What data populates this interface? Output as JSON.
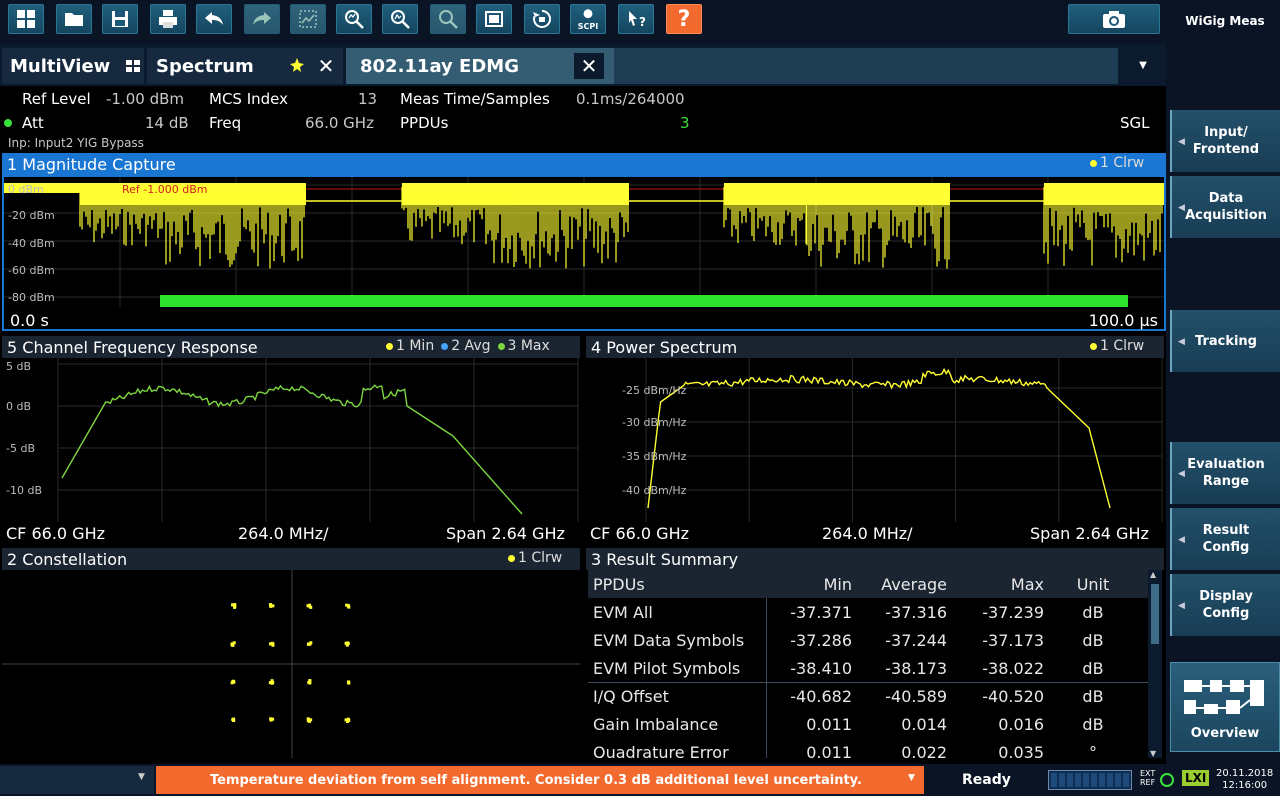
{
  "toolbar": {
    "icons": [
      "windows-icon",
      "open-folder-icon",
      "save-icon",
      "print-icon",
      "undo-icon",
      "redo-icon",
      "zoom-area-icon",
      "zoom-multi-icon",
      "zoom-result-icon",
      "zoom-off-icon",
      "fullscreen-icon",
      "sequence-icon",
      "sopi-icon",
      "help-pointer-icon",
      "help-icon"
    ],
    "sopi_label": "SCPI",
    "help_label": "?",
    "app_name": "WiGig Meas"
  },
  "tabs": [
    {
      "label": "MultiView"
    },
    {
      "label": "Spectrum"
    },
    {
      "label": "802.11ay EDMG"
    }
  ],
  "info": {
    "ref_level_label": "Ref Level",
    "ref_level_value": "-1.00 dBm",
    "att_label": "Att",
    "att_value": "14 dB",
    "mcs_label": "MCS Index",
    "mcs_value": "13",
    "freq_label": "Freq",
    "freq_value": "66.0 GHz",
    "meas_label": "Meas Time/Samples",
    "meas_value": "0.1ms/264000",
    "ppdus_label": "PPDUs",
    "ppdus_value": "3",
    "sgl": "SGL",
    "input": "Inp: Input2 YIG Bypass"
  },
  "win1": {
    "title": "1 Magnitude Capture",
    "legend": "1 Clrw",
    "ref_label": "Ref -1.000 dBm",
    "y_ticks": [
      "0 dBm",
      "-20 dBm",
      "-40 dBm",
      "-60 dBm",
      "-80 dBm"
    ],
    "x_start": "0.0 s",
    "x_end": "100.0 µs"
  },
  "win5": {
    "title": "5 Channel Frequency Response",
    "legend": [
      "1 Min",
      "2 Avg",
      "3 Max"
    ],
    "y_ticks": [
      "5 dB",
      "0 dB",
      "-5 dB",
      "-10 dB"
    ],
    "cf": "CF 66.0 GHz",
    "div": "264.0 MHz/",
    "span": "Span 2.64 GHz"
  },
  "win4": {
    "title": "4 Power Spectrum",
    "legend": "1 Clrw",
    "y_ticks": [
      "-25 dBm/Hz",
      "-30 dBm/Hz",
      "-35 dBm/Hz",
      "-40 dBm/Hz"
    ],
    "cf": "CF 66.0 GHz",
    "div": "264.0 MHz/",
    "span": "Span 2.64 GHz"
  },
  "win2": {
    "title": "2 Constellation",
    "legend": "1 Clrw"
  },
  "win3": {
    "title": "3 Result Summary",
    "headers": [
      "PPDUs",
      "Min",
      "Average",
      "Max",
      "Unit"
    ],
    "rows": [
      {
        "name": "EVM All",
        "min": "-37.371",
        "avg": "-37.316",
        "max": "-37.239",
        "unit": "dB"
      },
      {
        "name": "EVM Data Symbols",
        "min": "-37.286",
        "avg": "-37.244",
        "max": "-37.173",
        "unit": "dB"
      },
      {
        "name": "EVM Pilot Symbols",
        "min": "-38.410",
        "avg": "-38.173",
        "max": "-38.022",
        "unit": "dB"
      },
      {
        "name": "I/Q Offset",
        "min": "-40.682",
        "avg": "-40.589",
        "max": "-40.520",
        "unit": "dB"
      },
      {
        "name": "Gain Imbalance",
        "min": "0.011",
        "avg": "0.014",
        "max": "0.016",
        "unit": "dB"
      },
      {
        "name": "Quadrature Error",
        "min": "0.011",
        "avg": "0.022",
        "max": "0.035",
        "unit": "°"
      }
    ]
  },
  "softkeys": [
    {
      "label": "Input/\nFrontend"
    },
    {
      "label": "Data\nAcquisition"
    },
    {
      "label": "Tracking"
    },
    {
      "label": "Evaluation\nRange"
    },
    {
      "label": "Result\nConfig"
    },
    {
      "label": "Display\nConfig"
    },
    {
      "label": "Overview"
    }
  ],
  "status": {
    "message": "Temperature deviation from self alignment. Consider 0.3 dB additional level uncertainty.",
    "ready": "Ready",
    "ext_ref": "EXT REF",
    "lxi": "LXI",
    "date": "20.11.2018",
    "time": "12:16:00"
  },
  "colors": {
    "trace_yellow": "#ffff33",
    "trace_green": "#7cd640",
    "active_blue": "#1976d2",
    "warning_orange": "#f26a2e",
    "sync_green": "#3be03b"
  }
}
